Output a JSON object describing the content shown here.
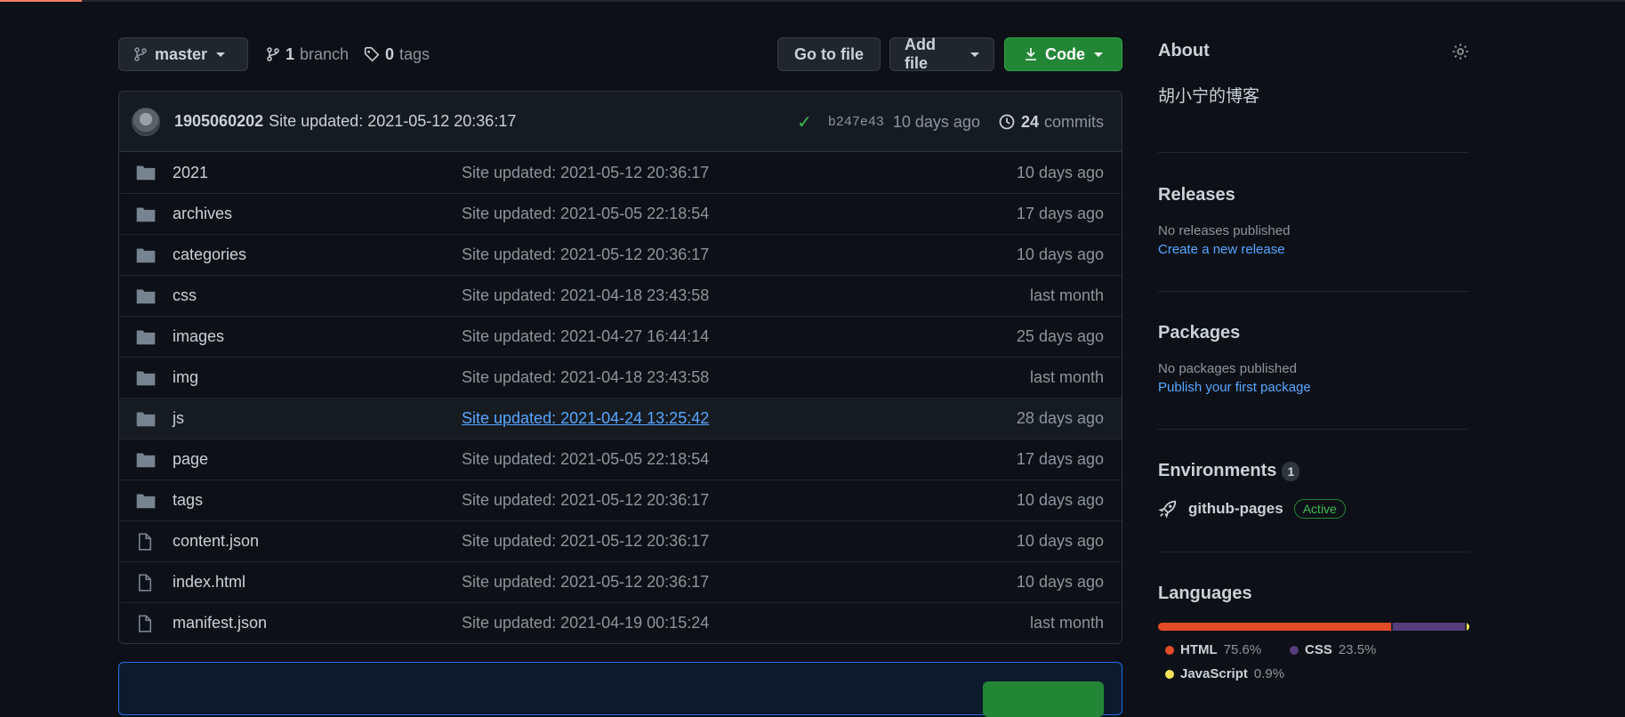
{
  "toolbar": {
    "branch_button": "master",
    "branch_count": "1",
    "branch_label": "branch",
    "tag_count": "0",
    "tag_label": "tags",
    "go_to_file": "Go to file",
    "add_file": "Add file",
    "code": "Code"
  },
  "commit": {
    "author": "1905060202",
    "message": "Site updated: 2021-05-12 20:36:17",
    "sha": "b247e43",
    "age": "10 days ago",
    "commit_count": "24",
    "commit_label": "commits"
  },
  "files": [
    {
      "name": "2021",
      "type": "folder",
      "message": "Site updated: 2021-05-12 20:36:17",
      "age": "10 days ago"
    },
    {
      "name": "archives",
      "type": "folder",
      "message": "Site updated: 2021-05-05 22:18:54",
      "age": "17 days ago"
    },
    {
      "name": "categories",
      "type": "folder",
      "message": "Site updated: 2021-05-12 20:36:17",
      "age": "10 days ago"
    },
    {
      "name": "css",
      "type": "folder",
      "message": "Site updated: 2021-04-18 23:43:58",
      "age": "last month"
    },
    {
      "name": "images",
      "type": "folder",
      "message": "Site updated: 2021-04-27 16:44:14",
      "age": "25 days ago"
    },
    {
      "name": "img",
      "type": "folder",
      "message": "Site updated: 2021-04-18 23:43:58",
      "age": "last month"
    },
    {
      "name": "js",
      "type": "folder",
      "message": "Site updated: 2021-04-24 13:25:42",
      "age": "28 days ago"
    },
    {
      "name": "page",
      "type": "folder",
      "message": "Site updated: 2021-05-05 22:18:54",
      "age": "17 days ago"
    },
    {
      "name": "tags",
      "type": "folder",
      "message": "Site updated: 2021-05-12 20:36:17",
      "age": "10 days ago"
    },
    {
      "name": "content.json",
      "type": "file",
      "message": "Site updated: 2021-05-12 20:36:17",
      "age": "10 days ago"
    },
    {
      "name": "index.html",
      "type": "file",
      "message": "Site updated: 2021-05-12 20:36:17",
      "age": "10 days ago"
    },
    {
      "name": "manifest.json",
      "type": "file",
      "message": "Site updated: 2021-04-19 00:15:24",
      "age": "last month"
    }
  ],
  "sidebar": {
    "about_title": "About",
    "about_desc": "胡小宁的博客",
    "releases_title": "Releases",
    "releases_none": "No releases published",
    "releases_link": "Create a new release",
    "packages_title": "Packages",
    "packages_none": "No packages published",
    "packages_link": "Publish your first package",
    "environments_title": "Environments",
    "environments_count": "1",
    "environment_name": "github-pages",
    "environment_status": "Active",
    "languages_title": "Languages",
    "languages": [
      {
        "name": "HTML",
        "percent": "75.6%",
        "color": "#e34c26"
      },
      {
        "name": "CSS",
        "percent": "23.5%",
        "color": "#563d7c"
      },
      {
        "name": "JavaScript",
        "percent": "0.9%",
        "color": "#f1e05a"
      }
    ]
  },
  "colors": {
    "background": "#0d1117",
    "accent_blue": "#58a6ff",
    "accent_green": "#238636"
  }
}
